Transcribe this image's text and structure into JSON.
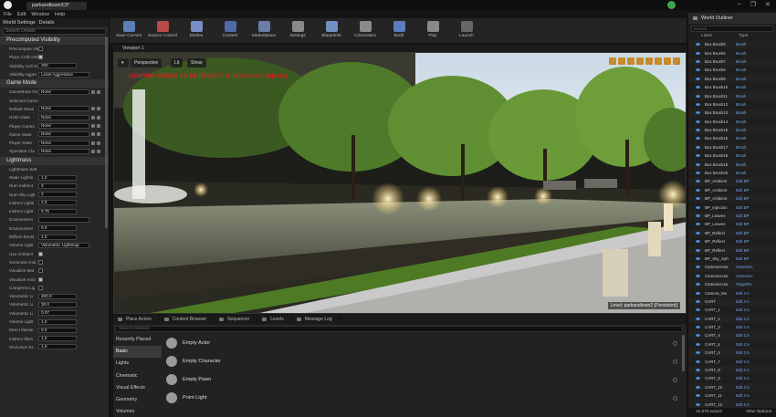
{
  "window": {
    "tab_title": "parkandtown/CP",
    "controls": [
      "–",
      "❐",
      "✕"
    ]
  },
  "menu": [
    "File",
    "Edit",
    "Window",
    "Help"
  ],
  "left_panel": {
    "tabs": [
      "World Settings",
      "Details"
    ],
    "search_placeholder": "Search Details",
    "sections": [
      {
        "title": "Precomputed Visibility",
        "rows": [
          {
            "label": "Precompute Vis",
            "type": "check",
            "value": ""
          },
          {
            "label": "Place Cells Only",
            "type": "check",
            "value": ""
          },
          {
            "label": "Visibility Cell Si",
            "type": "field",
            "value": "200"
          },
          {
            "label": "Visibility Aggre",
            "type": "field",
            "value": "Least Aggressive"
          }
        ]
      },
      {
        "title": "Game Mode",
        "rows": [
          {
            "label": "GameMode Ov",
            "type": "field",
            "value": "None"
          },
          {
            "label": "Selected Game",
            "type": "text",
            "value": ""
          },
          {
            "label": "Default Pawn",
            "type": "field",
            "value": "None"
          },
          {
            "label": "HUD Class",
            "type": "field",
            "value": "None"
          },
          {
            "label": "Player Contro",
            "type": "field",
            "value": "None"
          },
          {
            "label": "Game State",
            "type": "field",
            "value": "None"
          },
          {
            "label": "Player State",
            "type": "field",
            "value": "None"
          },
          {
            "label": "Spectator Cla",
            "type": "field",
            "value": "None"
          }
        ]
      },
      {
        "title": "Lightmass",
        "rows": [
          {
            "label": "Lightmass Sett",
            "type": "text",
            "value": ""
          },
          {
            "label": "Static Lightin",
            "type": "field",
            "value": "1.0"
          },
          {
            "label": "Num Indirect",
            "type": "field",
            "value": "3"
          },
          {
            "label": "Num Sky Ligh",
            "type": "field",
            "value": "3"
          },
          {
            "label": "Indirect Lighti",
            "type": "field",
            "value": "2.0"
          },
          {
            "label": "Indirect Light",
            "type": "field",
            "value": "0.75"
          },
          {
            "label": "Environment",
            "type": "field",
            "value": ""
          },
          {
            "label": "Environment",
            "type": "field",
            "value": "0.0"
          },
          {
            "label": "Diffuse Boost",
            "type": "field",
            "value": "1.0"
          },
          {
            "label": "Volume Light",
            "type": "field",
            "value": "Volumetric Lightmap"
          },
          {
            "label": "Use Ambient",
            "type": "check",
            "value": ""
          },
          {
            "label": "Generate Amb",
            "type": "check",
            "value": ""
          },
          {
            "label": "Visualize Mat",
            "type": "check",
            "value": ""
          },
          {
            "label": "Visualize Amb",
            "type": "check",
            "value": ""
          },
          {
            "label": "Compress Lig",
            "type": "check",
            "value": ""
          },
          {
            "label": "Volumetric Li",
            "type": "field",
            "value": "200.0"
          },
          {
            "label": "Volumetric Li",
            "type": "field",
            "value": "30.0"
          },
          {
            "label": "Volumetric Li",
            "type": "field",
            "value": "0.07"
          },
          {
            "label": "Volume Light",
            "type": "field",
            "value": "1.0"
          },
          {
            "label": "Direct Illumin",
            "type": "field",
            "value": "0.5"
          },
          {
            "label": "Indirect Illum",
            "type": "field",
            "value": "1.0"
          },
          {
            "label": "Occlusion Ex",
            "type": "field",
            "value": "1.0"
          }
        ]
      }
    ]
  },
  "toolbar": [
    {
      "label": "Save Current",
      "color": "#5b7fb6"
    },
    {
      "label": "Source Control",
      "color": "#b94a4a"
    },
    {
      "label": "Modes",
      "color": "#7a8fc8"
    },
    {
      "label": "Content",
      "color": "#4e6aa8"
    },
    {
      "label": "Marketplace",
      "color": "#6b7ea8"
    },
    {
      "label": "Settings",
      "color": "#8a8a8a"
    },
    {
      "label": "Blueprints",
      "color": "#7090c0"
    },
    {
      "label": "Cinematics",
      "color": "#8a8a8a"
    },
    {
      "label": "Build",
      "color": "#5a7cc0"
    },
    {
      "label": "Play",
      "color": "#8a8a8a"
    },
    {
      "label": "Launch",
      "color": "#666666"
    }
  ],
  "viewport": {
    "tab_label": "Viewport 1",
    "perspective": "Perspective",
    "lit": "Lit",
    "show": "Show",
    "warning": "LIGHTING NEEDS TO BE REBUILT (1,101 unbuilt objects)",
    "level": "Level: parkandtown2 (Persistent)"
  },
  "bottom_panel": {
    "tabs": [
      "Place Actors",
      "Content Browser",
      "Sequencer",
      "Levels",
      "Message Log"
    ],
    "search_placeholder": "Search Classes",
    "categories": [
      "Recently Placed",
      "Basic",
      "Lights",
      "Cinematic",
      "Visual Effects",
      "Geometry",
      "Volumes"
    ],
    "selected_category": "Basic",
    "items": [
      "Empty Actor",
      "Empty Character",
      "Empty Pawn",
      "Point Light"
    ]
  },
  "outliner": {
    "tab": "World Outliner",
    "search_placeholder": "Search...",
    "columns": [
      "Label",
      "Type"
    ],
    "rows": [
      [
        "Box Brush5",
        "Brush"
      ],
      [
        "Box Brush6",
        "Brush"
      ],
      [
        "Box Brush7",
        "Brush"
      ],
      [
        "Box Brush8",
        "Brush"
      ],
      [
        "Box Brush9",
        "Brush"
      ],
      [
        "Box Brush10",
        "Brush"
      ],
      [
        "Box Brush11",
        "Brush"
      ],
      [
        "Box Brush12",
        "Brush"
      ],
      [
        "Box Brush13",
        "Brush"
      ],
      [
        "Box Brush14",
        "Brush"
      ],
      [
        "Box Brush15",
        "Brush"
      ],
      [
        "Box Brush16",
        "Brush"
      ],
      [
        "Box Brush17",
        "Brush"
      ],
      [
        "Box Brush18",
        "Brush"
      ],
      [
        "Box Brush19",
        "Brush"
      ],
      [
        "Box Brush20",
        "Brush"
      ],
      [
        "BP_Ambient",
        "Edit BP"
      ],
      [
        "BP_Ambient",
        "Edit BP"
      ],
      [
        "BP_Ambient",
        "Edit BP"
      ],
      [
        "BP_Injection",
        "Edit BP"
      ],
      [
        "BP_Leaves",
        "Edit BP"
      ],
      [
        "BP_Leaves",
        "Edit BP"
      ],
      [
        "BP_Reflect",
        "Edit BP"
      ],
      [
        "BP_Reflect",
        "Edit BP"
      ],
      [
        "BP_Reflect",
        "Edit BP"
      ],
      [
        "BP_Sky_Sph",
        "Edit BP"
      ],
      [
        "CameraActor",
        "CameraA"
      ],
      [
        "CameraActor",
        "CameraA"
      ],
      [
        "CameraActor",
        "TargetPo"
      ],
      [
        "Camera_Mo",
        "Edit CA"
      ],
      [
        "CART",
        "Edit CA"
      ],
      [
        "CART_1",
        "Edit CA"
      ],
      [
        "CART_2",
        "Edit CA"
      ],
      [
        "CART_3",
        "Edit CA"
      ],
      [
        "CART_4",
        "Edit CA"
      ],
      [
        "CART_5",
        "Edit CA"
      ],
      [
        "CART_6",
        "Edit CA"
      ],
      [
        "CART_7",
        "Edit CA"
      ],
      [
        "CART_8",
        "Edit CA"
      ],
      [
        "CART_9",
        "Edit CA"
      ],
      [
        "CART_10",
        "Edit CA"
      ],
      [
        "CART_11",
        "Edit CA"
      ],
      [
        "CART_12",
        "Edit CA"
      ]
    ],
    "footer_count": "12,576 actors",
    "view_options": "View Options"
  }
}
